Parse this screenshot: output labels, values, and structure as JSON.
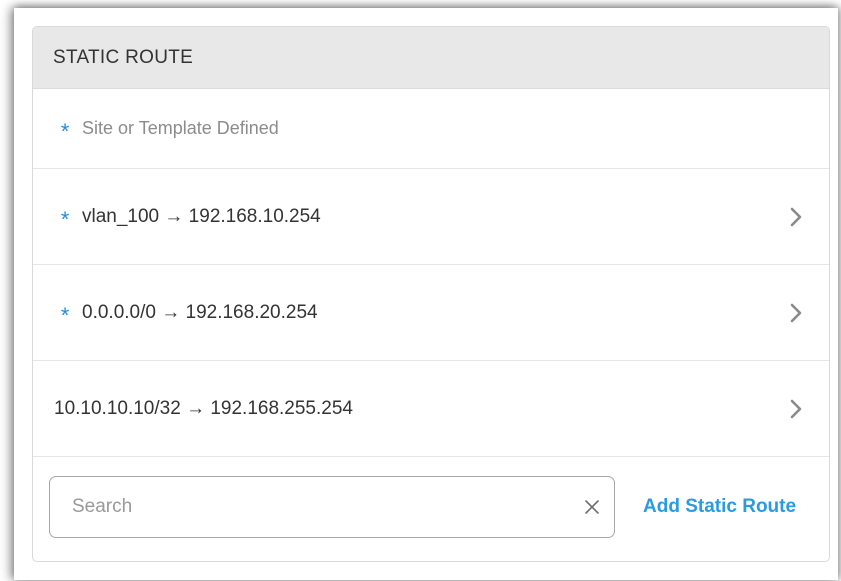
{
  "panel": {
    "title": "STATIC ROUTE",
    "legend": {
      "marker": "*",
      "text": "Site or Template Defined"
    },
    "routes": [
      {
        "text": "vlan_100 → 192.168.10.254",
        "inherited": true
      },
      {
        "text": "0.0.0.0/0 → 192.168.20.254",
        "inherited": true
      },
      {
        "text": "10.10.10.10/32 → 192.168.255.254",
        "inherited": false
      }
    ],
    "search": {
      "placeholder": "Search",
      "value": ""
    },
    "add_label": "Add Static Route"
  },
  "icons": {
    "marker": "asterisk-icon",
    "row_chevron": "chevron-right-icon",
    "clear": "close-icon"
  },
  "colors": {
    "accent": "#2a9be0",
    "marker": "#2a8bd6",
    "header_bg": "#e8e8e8"
  }
}
